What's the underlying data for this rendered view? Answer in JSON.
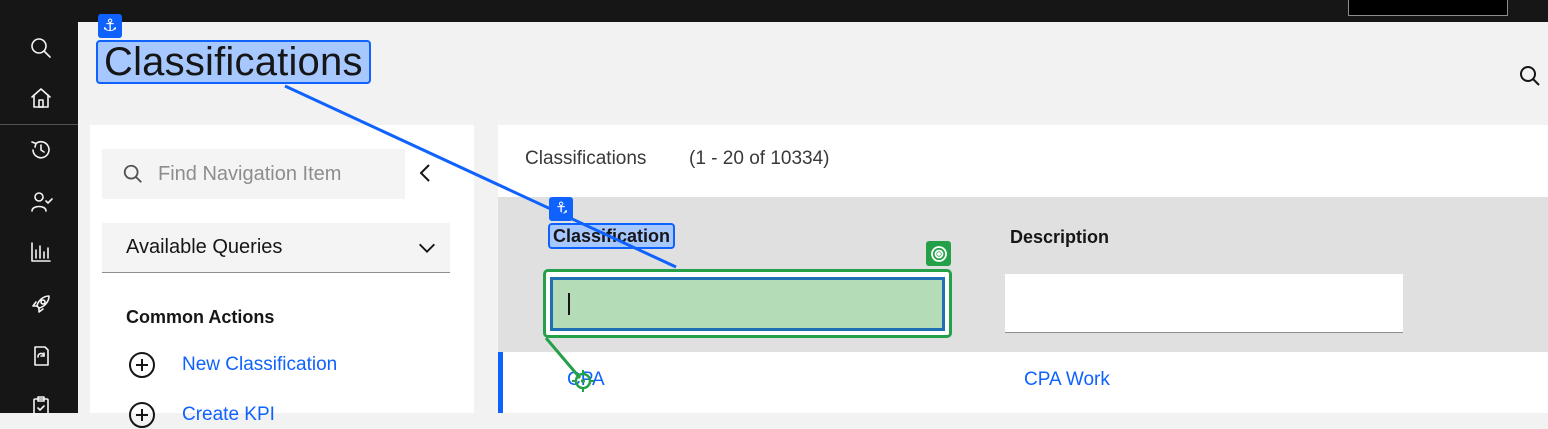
{
  "colors": {
    "accent": "#0f62fe",
    "highlight": "#a6c8ff",
    "target": "#24a148",
    "nav_bg": "#161616"
  },
  "sidenav": {
    "items": [
      {
        "icon": "search-icon"
      },
      {
        "icon": "home-icon"
      },
      {
        "icon": "history-icon"
      },
      {
        "icon": "user-check-icon"
      },
      {
        "icon": "bar-chart-icon"
      },
      {
        "icon": "rocket-icon"
      },
      {
        "icon": "document-refresh-icon"
      },
      {
        "icon": "clipboard-icon"
      }
    ]
  },
  "page": {
    "title": "Classifications"
  },
  "left_panel": {
    "search_placeholder": "Find Navigation Item",
    "queries_label": "Available Queries",
    "common_actions_label": "Common Actions",
    "actions": [
      {
        "label": "New Classification",
        "icon": "add-circle-icon"
      },
      {
        "label": "Create KPI",
        "icon": "add-circle-icon"
      }
    ]
  },
  "table": {
    "title": "Classifications",
    "count": "(1 - 20 of 10334)",
    "columns": [
      "Classification",
      "Description"
    ],
    "filter_values": [
      "",
      ""
    ],
    "rows": [
      {
        "classification": "CPA",
        "description": "CPA Work"
      }
    ]
  }
}
